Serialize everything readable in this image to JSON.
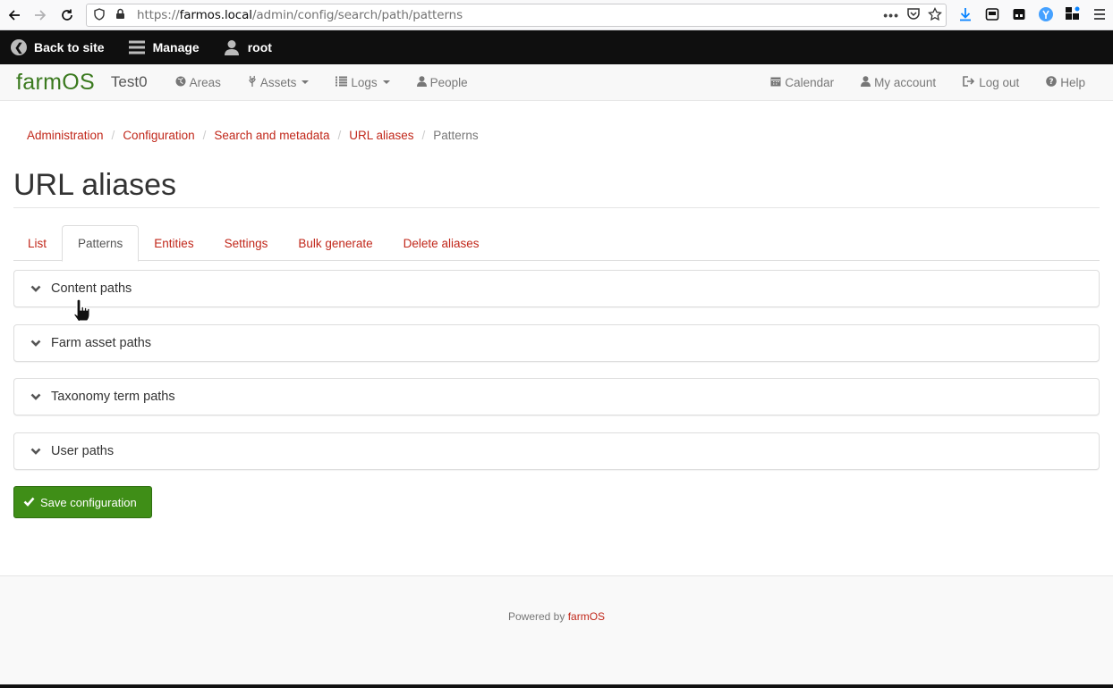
{
  "browser": {
    "url_prefix": "https://",
    "url_domain": "farmos.local",
    "url_path": "/admin/config/search/path/patterns",
    "icons": [
      "back-icon",
      "forward-icon",
      "reload-icon",
      "shield-icon",
      "lock-icon",
      "more-icon",
      "pocket-icon",
      "bookmark-star-icon",
      "download-icon",
      "library-icon",
      "container-icon",
      "extension-icon",
      "addons-icon",
      "menu-icon"
    ]
  },
  "toolbar": {
    "back_to_site": "Back to site",
    "manage": "Manage",
    "user": "root"
  },
  "navbar": {
    "brand": "farmOS",
    "site_name": "Test0",
    "links": [
      {
        "label": "Areas",
        "icon": "globe-icon",
        "dropdown": false
      },
      {
        "label": "Assets",
        "icon": "leaf-icon",
        "dropdown": true
      },
      {
        "label": "Logs",
        "icon": "list-icon",
        "dropdown": true
      },
      {
        "label": "People",
        "icon": "user-icon",
        "dropdown": false
      }
    ],
    "right_links": [
      {
        "label": "Calendar",
        "icon": "calendar-icon"
      },
      {
        "label": "My account",
        "icon": "user-icon"
      },
      {
        "label": "Log out",
        "icon": "logout-icon"
      },
      {
        "label": "Help",
        "icon": "help-icon"
      }
    ]
  },
  "breadcrumb": [
    "Administration",
    "Configuration",
    "Search and metadata",
    "URL aliases",
    "Patterns"
  ],
  "page_title": "URL aliases",
  "tabs": [
    {
      "label": "List",
      "active": false
    },
    {
      "label": "Patterns",
      "active": true
    },
    {
      "label": "Entities",
      "active": false
    },
    {
      "label": "Settings",
      "active": false
    },
    {
      "label": "Bulk generate",
      "active": false
    },
    {
      "label": "Delete aliases",
      "active": false
    }
  ],
  "panels": [
    "Content paths",
    "Farm asset paths",
    "Taxonomy term paths",
    "User paths"
  ],
  "save_button": "Save configuration",
  "footer": {
    "prefix": "Powered by",
    "link": "farmOS"
  },
  "colors": {
    "link": "#c1271a",
    "brand": "#3b7a1f",
    "save_button": "#3f8e17",
    "toolbar": "#0f0f0f"
  }
}
